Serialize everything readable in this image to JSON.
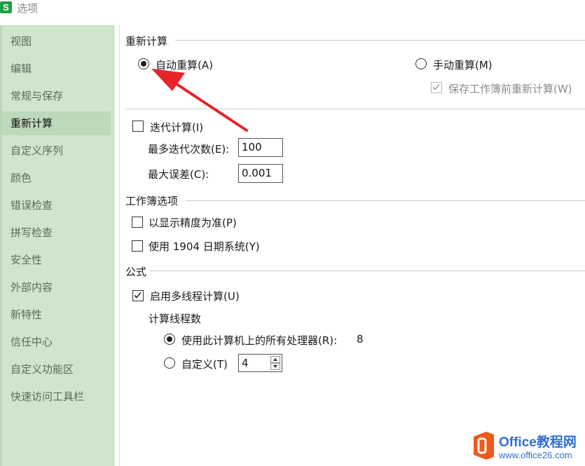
{
  "window": {
    "title": "选项",
    "app_icon_letter": "S"
  },
  "sidebar": {
    "items": [
      {
        "label": "视图"
      },
      {
        "label": "编辑"
      },
      {
        "label": "常规与保存"
      },
      {
        "label": "重新计算",
        "active": true
      },
      {
        "label": "自定义序列"
      },
      {
        "label": "颜色"
      },
      {
        "label": "错误检查"
      },
      {
        "label": "拼写检查"
      },
      {
        "label": "安全性"
      },
      {
        "label": "外部内容"
      },
      {
        "label": "新特性"
      },
      {
        "label": "信任中心"
      },
      {
        "label": "自定义功能区"
      },
      {
        "label": "快速访问工具栏"
      }
    ]
  },
  "recalc": {
    "title": "重新计算",
    "auto_label": "自动重算(A)",
    "auto_checked": true,
    "manual_label": "手动重算(M)",
    "manual_checked": false,
    "save_before_label": "保存工作簿前重新计算(W)",
    "save_before_checked": true,
    "save_before_disabled": true,
    "iterate_label": "迭代计算(I)",
    "iterate_checked": false,
    "max_iter_label": "最多迭代次数(E):",
    "max_iter_value": "100",
    "max_change_label": "最大误差(C):",
    "max_change_value": "0.001"
  },
  "workbook": {
    "title": "工作簿选项",
    "precision_label": "以显示精度为准(P)",
    "precision_checked": false,
    "date1904_label": "使用 1904 日期系统(Y)",
    "date1904_checked": false
  },
  "formula": {
    "title": "公式",
    "multithread_label": "启用多线程计算(U)",
    "multithread_checked": true,
    "threads_title": "计算线程数",
    "all_procs_label": "使用此计算机上的所有处理器(R):",
    "all_procs_count": "8",
    "all_procs_checked": true,
    "custom_label": "自定义(T)",
    "custom_checked": false,
    "custom_value": "4"
  },
  "watermark": {
    "brand": "Office教程网",
    "url": "www.office26.com"
  },
  "colors": {
    "sidebar_bg": "#cfe6cd",
    "sidebar_active": "#bdd8ba",
    "annotation_arrow": "#e8232a",
    "watermark_blue": "#2f6fcf",
    "watermark_orange": "#f05a1a"
  }
}
